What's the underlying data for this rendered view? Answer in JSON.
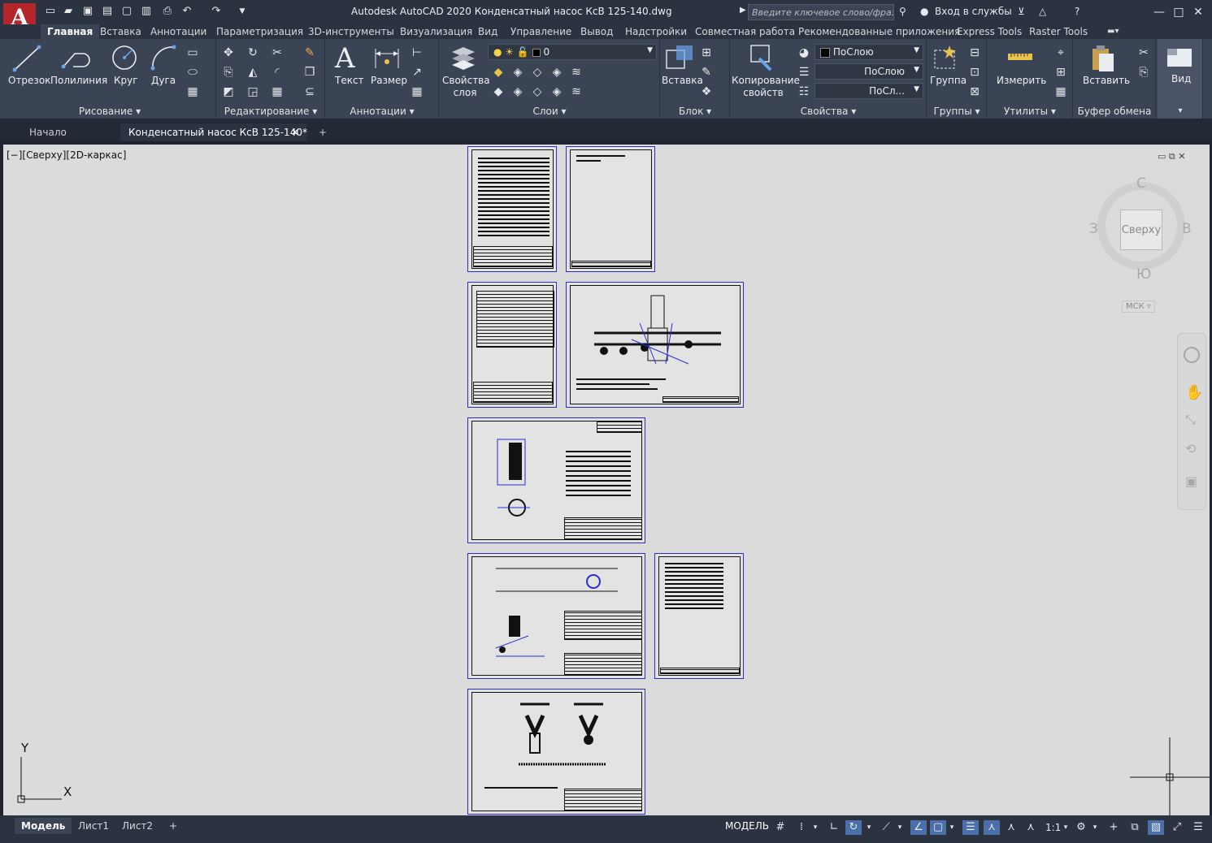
{
  "app": {
    "title": "Autodesk AutoCAD 2020   Конденсатный насос КсВ 125-140.dwg",
    "logo": "A",
    "search_placeholder": "Введите ключевое слово/фразу",
    "signin": "Вход в службы",
    "qat_icons": [
      "new-icon",
      "open-icon",
      "save-icon",
      "saveas-icon",
      "open-web-icon",
      "save-web-icon",
      "plot-icon",
      "undo-icon",
      "redo-icon",
      "dropdown-icon"
    ]
  },
  "ribbon_tabs": [
    "Главная",
    "Вставка",
    "Аннотации",
    "Параметризация",
    "3D-инструменты",
    "Визуализация",
    "Вид",
    "Управление",
    "Вывод",
    "Надстройки",
    "Совместная работа",
    "Рекомендованные приложения",
    "Express Tools",
    "Raster Tools"
  ],
  "panels": {
    "draw": {
      "title": "Рисование",
      "tools": [
        "Отрезок",
        "Полилиния",
        "Круг",
        "Дуга"
      ]
    },
    "modify": {
      "title": "Редактирование"
    },
    "annotation": {
      "title": "Аннотации",
      "tools": [
        "Текст",
        "Размер"
      ]
    },
    "layers": {
      "title": "Слои",
      "tool": "Свойства слоя",
      "current_layer": "0"
    },
    "block": {
      "title": "Блок",
      "tool": "Вставка"
    },
    "properties": {
      "title": "Свойства",
      "match_tool": "Копирование свойств",
      "color": "ПоСлою",
      "linetype": "ПоСлою",
      "lineweight": "ПоСл..."
    },
    "groups": {
      "title": "Группы",
      "tool": "Группа"
    },
    "utilities": {
      "title": "Утилиты",
      "tool": "Измерить"
    },
    "clipboard": {
      "title": "Буфер обмена",
      "tool": "Вставить"
    },
    "view": {
      "title": "Вид"
    }
  },
  "doc_tabs": {
    "start": "Начало",
    "current": "Конденсатный насос КсВ 125-140*",
    "add": "+"
  },
  "viewport": {
    "label": "[−][Сверху][2D-каркас]"
  },
  "viewcube": {
    "face": "Сверху",
    "n": "С",
    "s": "Ю",
    "w": "З",
    "e": "В",
    "ucs": "МСК"
  },
  "ucs_icon": {
    "x": "X",
    "y": "Y"
  },
  "layout_tabs": [
    "Модель",
    "Лист1",
    "Лист2"
  ],
  "status": {
    "mode": "МОДЕЛЬ",
    "scale": "1:1"
  },
  "colors": {
    "accent": "#4b6fa8",
    "frame": "#2b2bd6",
    "logo": "#b3262b",
    "canvas": "#dbdbdb"
  }
}
